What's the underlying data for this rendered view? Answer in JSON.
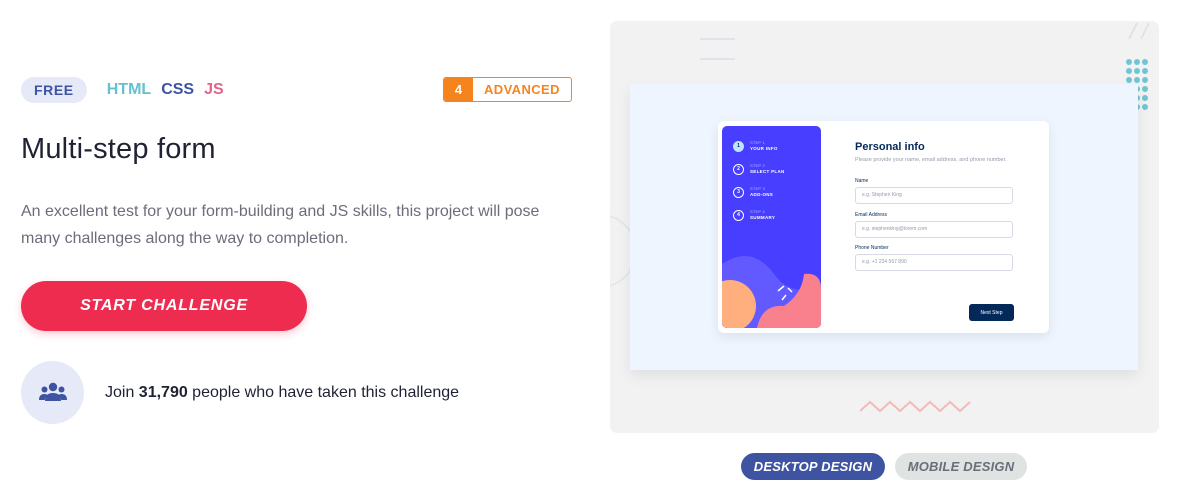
{
  "challenge": {
    "price_badge": "FREE",
    "languages": [
      "HTML",
      "CSS",
      "JS"
    ],
    "level_number": "4",
    "level_label": "ADVANCED",
    "title": "Multi-step form",
    "description": "An excellent test for your form-building and JS skills, this project will pose many challenges along the way to completion.",
    "start_button": "START CHALLENGE",
    "join": {
      "prefix": "Join ",
      "count": "31,790",
      "suffix": " people who have taken this challenge",
      "icon": "people-icon"
    }
  },
  "preview": {
    "steps": [
      {
        "num": "1",
        "small": "STEP 1",
        "label": "YOUR INFO"
      },
      {
        "num": "2",
        "small": "STEP 2",
        "label": "SELECT PLAN"
      },
      {
        "num": "3",
        "small": "STEP 3",
        "label": "ADD-ONS"
      },
      {
        "num": "4",
        "small": "STEP 4",
        "label": "SUMMARY"
      }
    ],
    "form_title": "Personal info",
    "form_subtitle": "Please provide your name, email address, and phone number.",
    "fields": [
      {
        "label": "Name",
        "placeholder": "e.g. Stephen King"
      },
      {
        "label": "Email Address",
        "placeholder": "e.g. stephenking@lorem.com"
      },
      {
        "label": "Phone Number",
        "placeholder": "e.g. +1 234 567 890"
      }
    ],
    "next_button": "Next Step"
  },
  "design_tabs": {
    "desktop": "DESKTOP DESIGN",
    "mobile": "MOBILE DESIGN"
  },
  "colors": {
    "accent_red": "#ee2c4f",
    "brand_blue": "#3e54a3",
    "advanced_orange": "#f5841f",
    "html_color": "#63c1d1",
    "js_color": "#e3638b",
    "sidebar_purple": "#483eff"
  }
}
